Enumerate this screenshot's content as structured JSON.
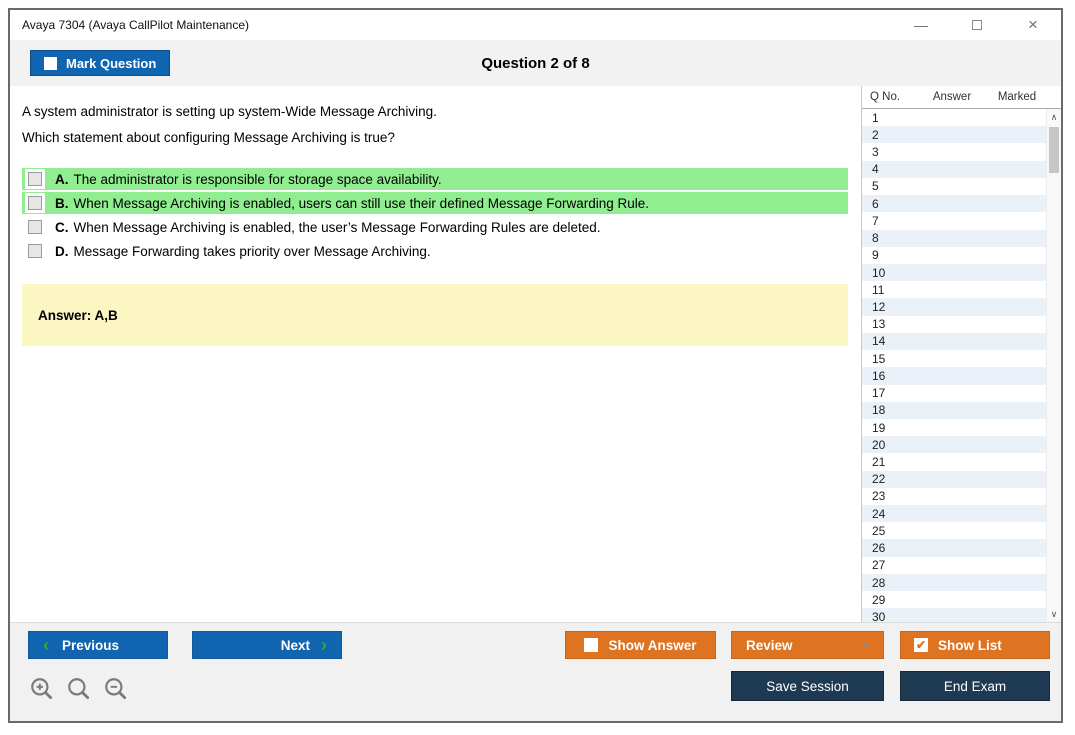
{
  "window": {
    "title": "Avaya 7304 (Avaya CallPilot Maintenance)"
  },
  "header": {
    "mark_question_label": "Mark Question",
    "question_counter": "Question 2 of 8"
  },
  "question": {
    "line1": "A system administrator is setting up system-Wide Message Archiving.",
    "line2": "Which statement about configuring Message Archiving is true?"
  },
  "options": [
    {
      "letter": "A.",
      "text": "The administrator is responsible for storage space availability.",
      "highlighted": true,
      "checked": false
    },
    {
      "letter": "B.",
      "text": "When Message Archiving is enabled, users can still use their defined Message Forwarding Rule.",
      "highlighted": true,
      "checked": false
    },
    {
      "letter": "C.",
      "text": "When Message Archiving is enabled, the user’s Message Forwarding Rules are deleted.",
      "highlighted": false,
      "checked": false
    },
    {
      "letter": "D.",
      "text": "Message Forwarding takes priority over Message Archiving.",
      "highlighted": false,
      "checked": false
    }
  ],
  "answer_box": {
    "label": "Answer: A,B"
  },
  "question_list": {
    "headers": {
      "q_no": "Q No.",
      "answer": "Answer",
      "marked": "Marked"
    },
    "rows": [
      {
        "q": "1",
        "answer": "",
        "marked": ""
      },
      {
        "q": "2",
        "answer": "",
        "marked": ""
      },
      {
        "q": "3",
        "answer": "",
        "marked": ""
      },
      {
        "q": "4",
        "answer": "",
        "marked": ""
      },
      {
        "q": "5",
        "answer": "",
        "marked": ""
      },
      {
        "q": "6",
        "answer": "",
        "marked": ""
      },
      {
        "q": "7",
        "answer": "",
        "marked": ""
      },
      {
        "q": "8",
        "answer": "",
        "marked": ""
      },
      {
        "q": "9",
        "answer": "",
        "marked": ""
      },
      {
        "q": "10",
        "answer": "",
        "marked": ""
      },
      {
        "q": "11",
        "answer": "",
        "marked": ""
      },
      {
        "q": "12",
        "answer": "",
        "marked": ""
      },
      {
        "q": "13",
        "answer": "",
        "marked": ""
      },
      {
        "q": "14",
        "answer": "",
        "marked": ""
      },
      {
        "q": "15",
        "answer": "",
        "marked": ""
      },
      {
        "q": "16",
        "answer": "",
        "marked": ""
      },
      {
        "q": "17",
        "answer": "",
        "marked": ""
      },
      {
        "q": "18",
        "answer": "",
        "marked": ""
      },
      {
        "q": "19",
        "answer": "",
        "marked": ""
      },
      {
        "q": "20",
        "answer": "",
        "marked": ""
      },
      {
        "q": "21",
        "answer": "",
        "marked": ""
      },
      {
        "q": "22",
        "answer": "",
        "marked": ""
      },
      {
        "q": "23",
        "answer": "",
        "marked": ""
      },
      {
        "q": "24",
        "answer": "",
        "marked": ""
      },
      {
        "q": "25",
        "answer": "",
        "marked": ""
      },
      {
        "q": "26",
        "answer": "",
        "marked": ""
      },
      {
        "q": "27",
        "answer": "",
        "marked": ""
      },
      {
        "q": "28",
        "answer": "",
        "marked": ""
      },
      {
        "q": "29",
        "answer": "",
        "marked": ""
      },
      {
        "q": "30",
        "answer": "",
        "marked": ""
      }
    ]
  },
  "footer": {
    "previous_label": "Previous",
    "next_label": "Next",
    "show_answer_label": "Show Answer",
    "review_label": "Review",
    "show_list_label": "Show List",
    "save_session_label": "Save Session",
    "end_exam_label": "End Exam"
  },
  "icons": {
    "minimize_glyph": "—",
    "close_glyph": "×",
    "chevron_left_glyph": "‹",
    "chevron_right_glyph": "›",
    "triangle_up_glyph": "▲",
    "check_glyph": "✔",
    "scroll_up_glyph": "∧",
    "scroll_down_glyph": "∨"
  },
  "colors": {
    "accent_blue": "#1164AF",
    "accent_orange": "#DE7321",
    "navy": "#1E3A52",
    "highlight_green": "#90EE90",
    "answer_yellow": "#FCF6C3",
    "row_alt_blue": "#EAF1F8",
    "bar_gray": "#F2F2F2",
    "chevron_green": "#2FAE2F"
  }
}
